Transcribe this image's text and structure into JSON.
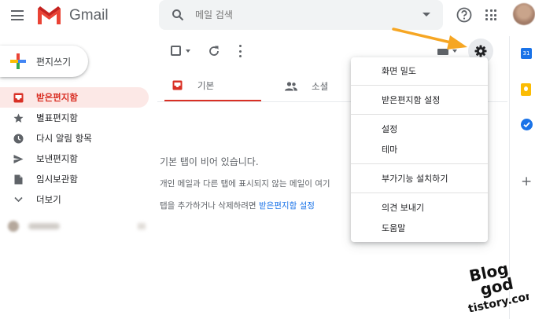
{
  "header": {
    "app_name": "Gmail",
    "search": {
      "placeholder": "메일 검색"
    }
  },
  "sidebar": {
    "compose_label": "편지쓰기",
    "items": [
      {
        "label": "받은편지함",
        "icon": "inbox-icon",
        "active": true
      },
      {
        "label": "별표편지함",
        "icon": "star-icon",
        "active": false
      },
      {
        "label": "다시 알림 항목",
        "icon": "clock-icon",
        "active": false
      },
      {
        "label": "보낸편지함",
        "icon": "send-icon",
        "active": false
      },
      {
        "label": "임시보관함",
        "icon": "draft-icon",
        "active": false
      },
      {
        "label": "더보기",
        "icon": "chevron-down-icon",
        "active": false
      }
    ]
  },
  "tabs": [
    {
      "label": "기본",
      "icon": "inbox-icon",
      "active": true
    },
    {
      "label": "소셜",
      "icon": "people-icon",
      "active": false
    }
  ],
  "empty_state": {
    "title": "기본 탭이 비어 있습니다.",
    "line1": "개인 메일과 다른 탭에 표시되지 않는 메일이 여기",
    "line2_pre": "탭을 추가하거나 삭제하려면 ",
    "line2_link": "받은편지함 설정"
  },
  "settings_menu": {
    "groups": [
      [
        "화면 밀도"
      ],
      [
        "받은편지함 설정"
      ],
      [
        "설정",
        "테마"
      ],
      [
        "부가기능 설치하기"
      ],
      [
        "의견 보내기",
        "도움말"
      ]
    ]
  },
  "side_panel": {
    "calendar_day": "31"
  },
  "watermark": {
    "line1": "Blog",
    "line2": "god",
    "line3": "tistory.com"
  },
  "colors": {
    "accent_red": "#d93025",
    "active_bg": "#fce8e6",
    "link_blue": "#1a73e8",
    "arrow_orange": "#f6a623"
  }
}
